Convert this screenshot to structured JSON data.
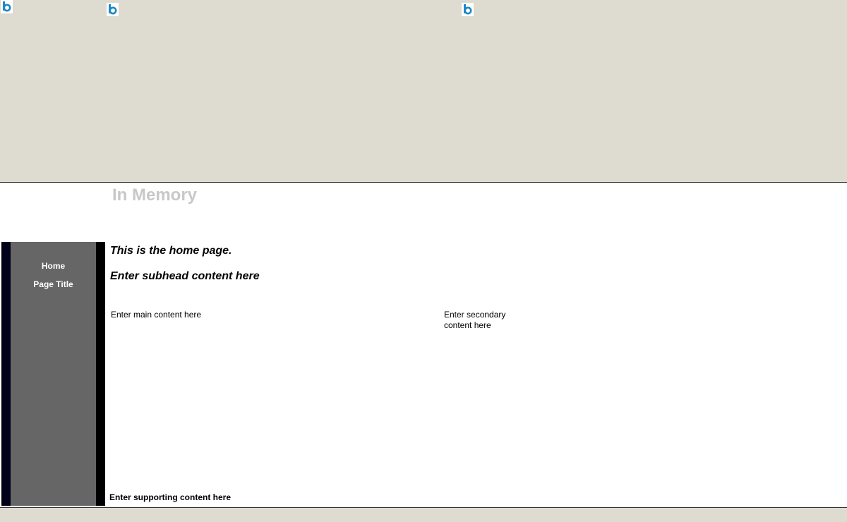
{
  "header": {
    "site_title": "In Memory",
    "icons": [
      "broken-image-icon",
      "broken-image-icon",
      "broken-image-icon"
    ]
  },
  "nav": {
    "items": [
      {
        "label": "Home"
      },
      {
        "label": "Page Title"
      }
    ]
  },
  "main": {
    "home_heading": "This is the home page.",
    "subhead": "Enter subhead content here",
    "main_content": "Enter main content here",
    "secondary_content": "Enter secondary content here",
    "supporting_content": "Enter supporting content here"
  },
  "colors": {
    "banner_bg": "#dedbd0",
    "nav_bg": "#666666",
    "nav_border": "#000000",
    "title_color": "#c8c8c8",
    "icon_blue": "#1e88c8"
  }
}
